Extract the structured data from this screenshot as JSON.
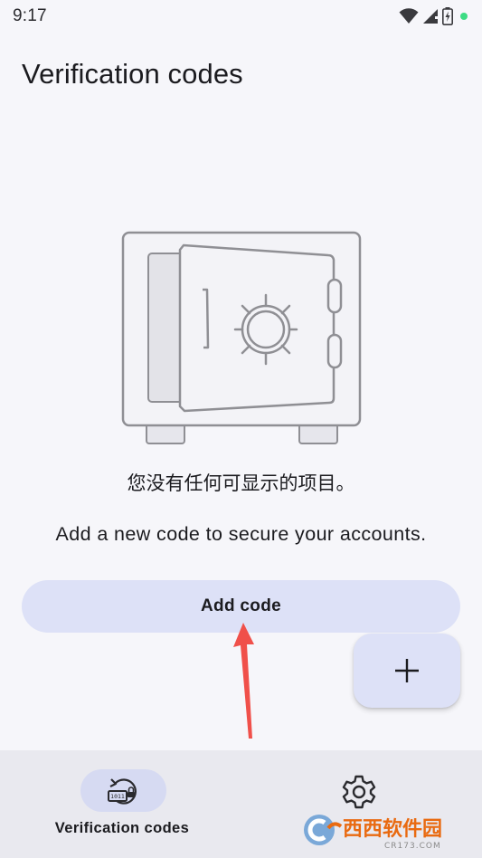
{
  "status_bar": {
    "time": "9:17",
    "icons": [
      "wifi-icon",
      "signal-icon",
      "battery-charging-icon",
      "notification-dot"
    ],
    "dot_color": "#3ddc84"
  },
  "page": {
    "title": "Verification codes"
  },
  "empty_state": {
    "illustration": "safe-illustration",
    "title": "您没有任何可显示的项目。",
    "subtitle": "Add a new code to secure your accounts."
  },
  "actions": {
    "add_code_label": "Add code",
    "fab_icon": "plus-icon"
  },
  "bottom_nav": {
    "items": [
      {
        "label": "Verification codes",
        "icon": "verification-codes-icon",
        "selected": true
      },
      {
        "icon": "gear-icon",
        "selected": false
      }
    ]
  },
  "watermark": {
    "text": "西西软件园",
    "site": "CR173.COM"
  },
  "colors": {
    "background": "#f6f6fa",
    "button": "#dde1f7",
    "nav_background": "#e9e9ef",
    "nav_selected_pill": "#d6daf2",
    "annotation_arrow": "#f0504a"
  }
}
